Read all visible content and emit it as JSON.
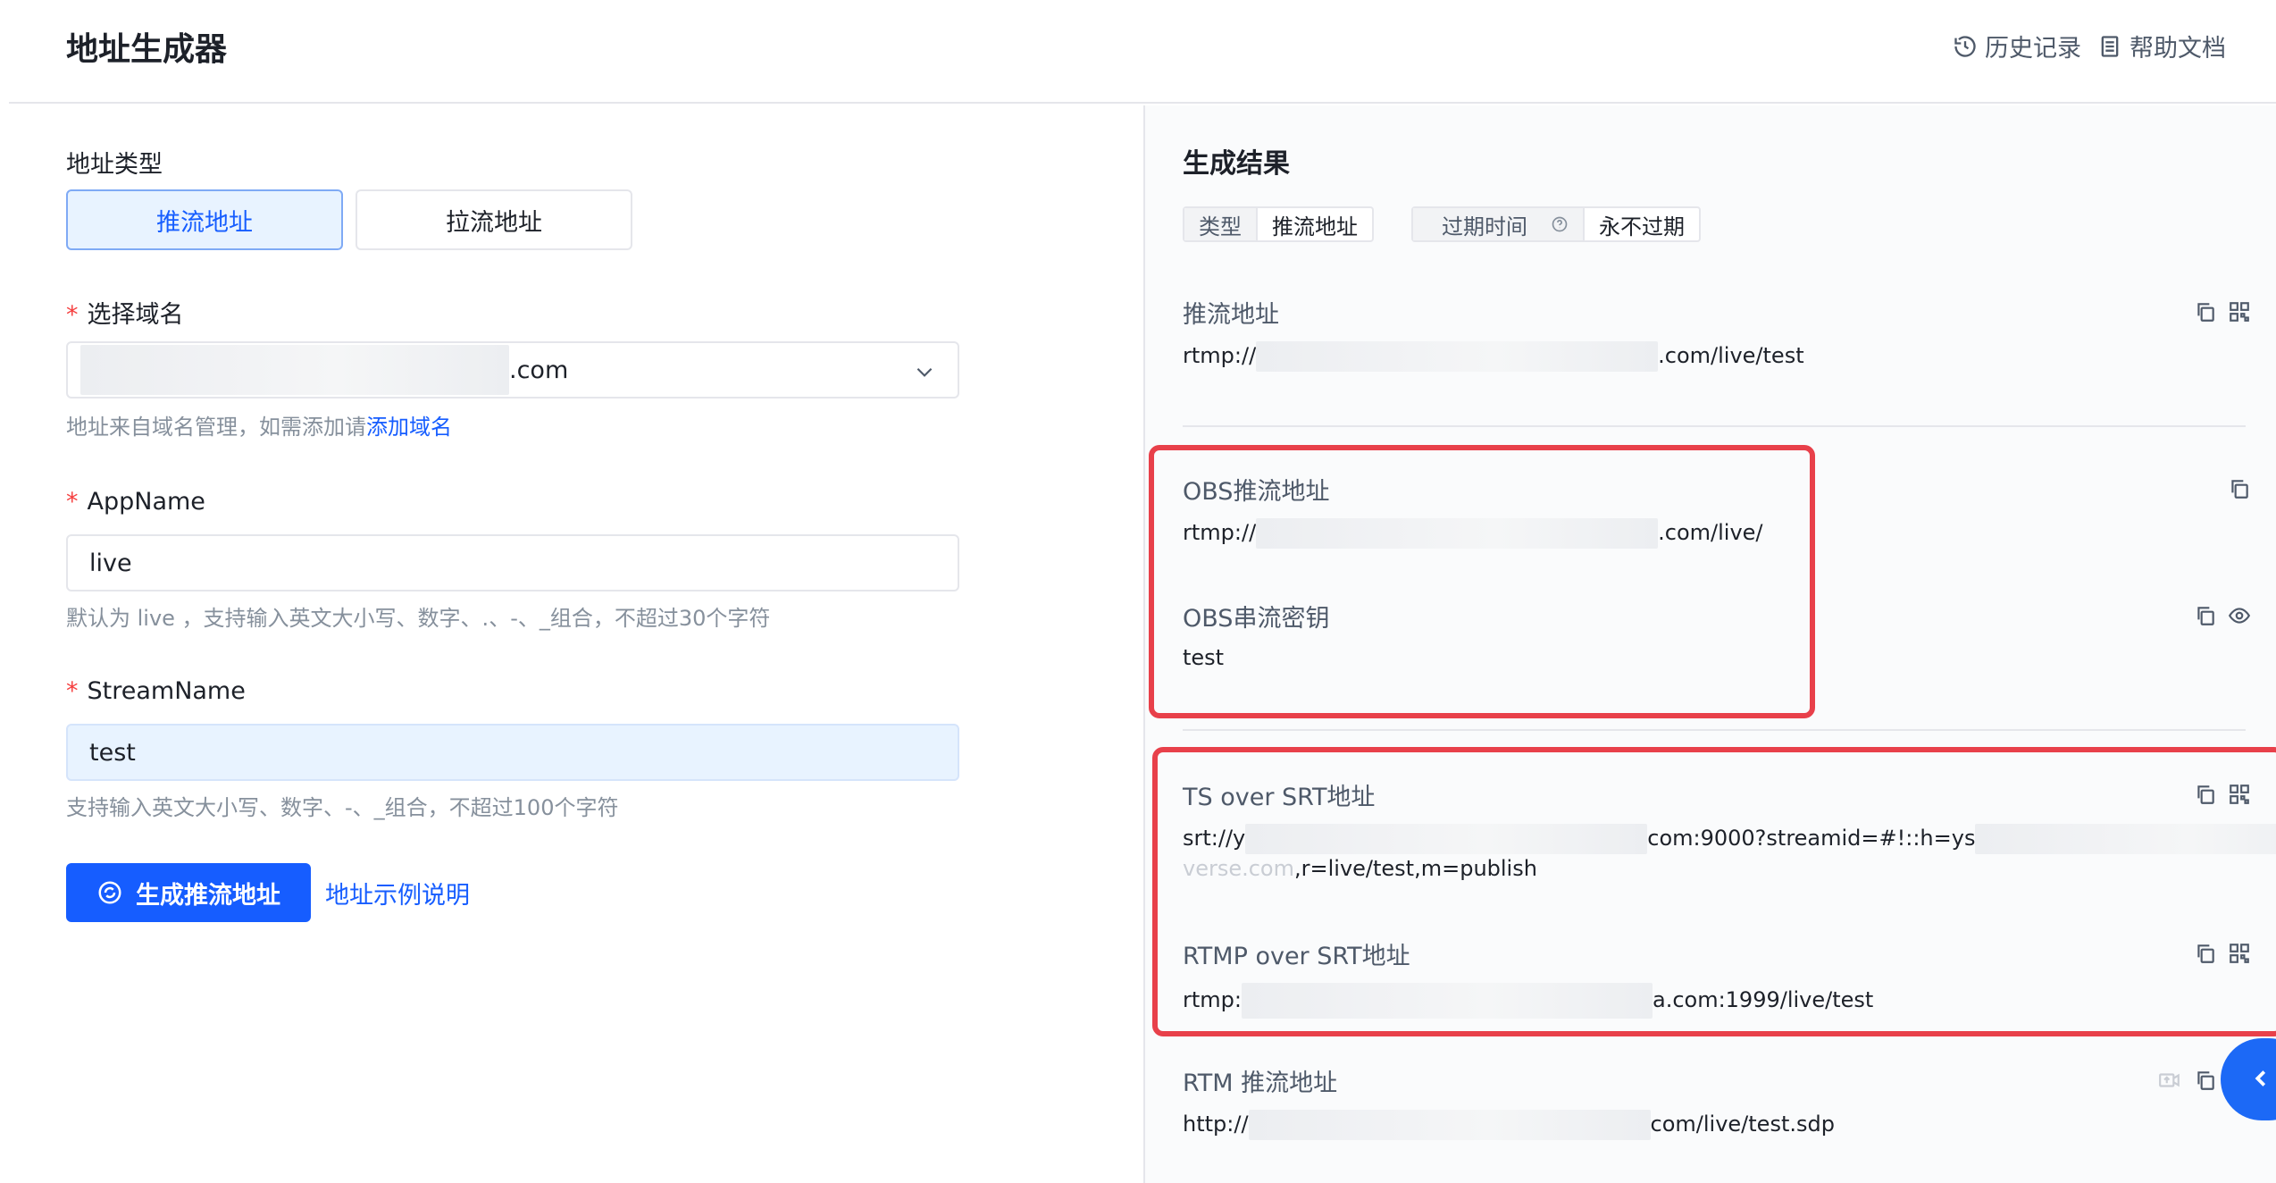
{
  "header": {
    "title": "地址生成器",
    "history_label": "历史记录",
    "help_label": "帮助文档"
  },
  "form": {
    "address_type_label": "地址类型",
    "address_types": [
      "推流地址",
      "拉流地址"
    ],
    "selected_type": "推流地址",
    "domain_label": "选择域名",
    "domain_suffix": ".com",
    "domain_hint_prefix": "地址来自域名管理，如需添加请",
    "domain_hint_link": "添加域名",
    "appname_label": "AppName",
    "appname_value": "live",
    "appname_hint": "默认为 live ，支持输入英文大小写、数字、.、-、_组合，不超过30个字符",
    "streamname_label": "StreamName",
    "streamname_value": "test",
    "streamname_hint": "支持输入英文大小写、数字、-、_组合，不超过100个字符",
    "generate_button": "生成推流地址",
    "example_link": "地址示例说明"
  },
  "result": {
    "title": "生成结果",
    "type_key": "类型",
    "type_value": "推流地址",
    "expire_key": "过期时间",
    "expire_value": "永不过期",
    "push_label": "推流地址",
    "push_prefix": "rtmp://",
    "push_suffix": ".com/live/test",
    "obs_label": "OBS推流地址",
    "obs_prefix": "rtmp://",
    "obs_suffix": ".com/live/",
    "obs_key_label": "OBS串流密钥",
    "obs_key_value": "test",
    "srt_label": "TS over SRT地址",
    "srt_prefix": "srt://y",
    "srt_mid": "com:9000?streamid=#!::h=ys",
    "srt_line2_fragment": "verse.com",
    "srt_line2": ",r=live/test,m=publish",
    "rtmp_srt_label": "RTMP over SRT地址",
    "rtmp_srt_prefix": "rtmp:",
    "rtmp_srt_suffix": "a.com:1999/live/test",
    "rtm_label": "RTM 推流地址",
    "rtm_prefix": "http://",
    "rtm_suffix": "com/live/test.sdp"
  },
  "colors": {
    "primary": "#165dff",
    "highlight_box": "#e8404a",
    "required": "#f53f3f"
  }
}
